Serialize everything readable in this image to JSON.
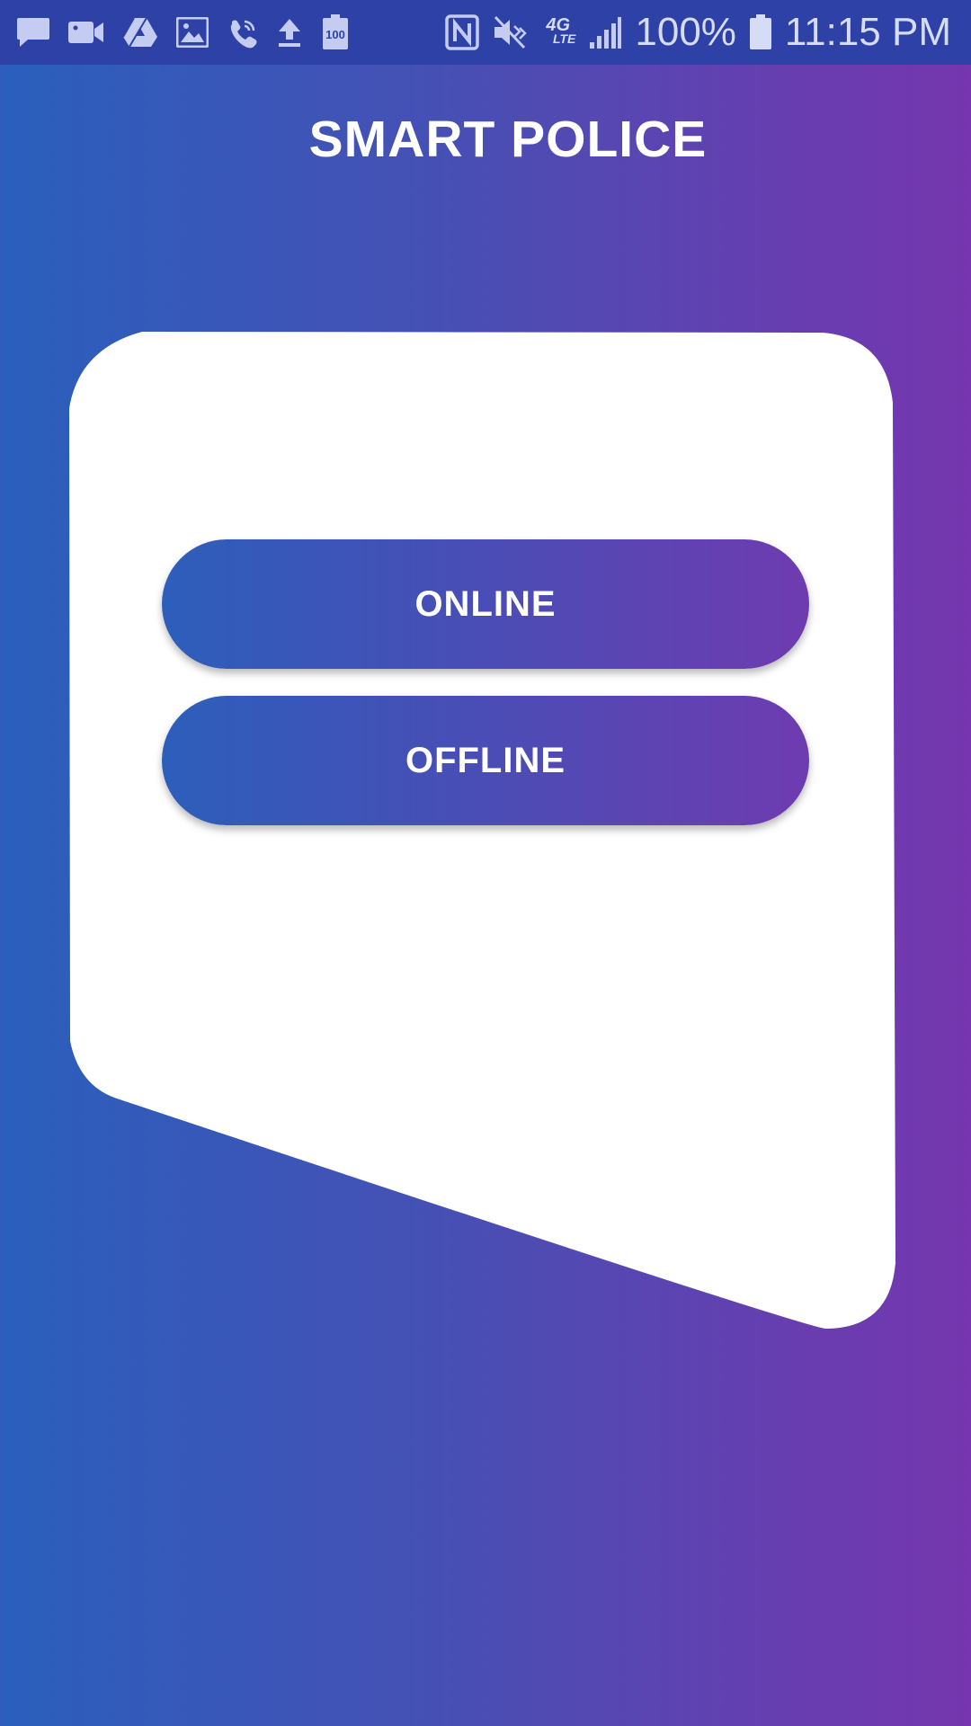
{
  "status_bar": {
    "left_icons": [
      "message-icon",
      "video-camera-icon",
      "drive-icon",
      "gallery-icon",
      "wifi-calling-icon",
      "upload-icon",
      "battery-saver-icon"
    ],
    "battery_saver_label": "100",
    "right_icons": [
      "nfc-icon",
      "mute-icon",
      "network-4g-lte-icon",
      "signal-icon",
      "battery-icon"
    ],
    "network_type_top": "4G",
    "network_type_bottom": "LTE",
    "battery_percent": "100%",
    "time": "11:15 PM"
  },
  "app": {
    "title": "SMART POLICE"
  },
  "actions": {
    "online_label": "ONLINE",
    "offline_label": "OFFLINE"
  },
  "colors": {
    "gradient_start": "#2a5fbd",
    "gradient_end": "#7536ae",
    "status_bar": "#2e41a6",
    "card": "#ffffff"
  }
}
